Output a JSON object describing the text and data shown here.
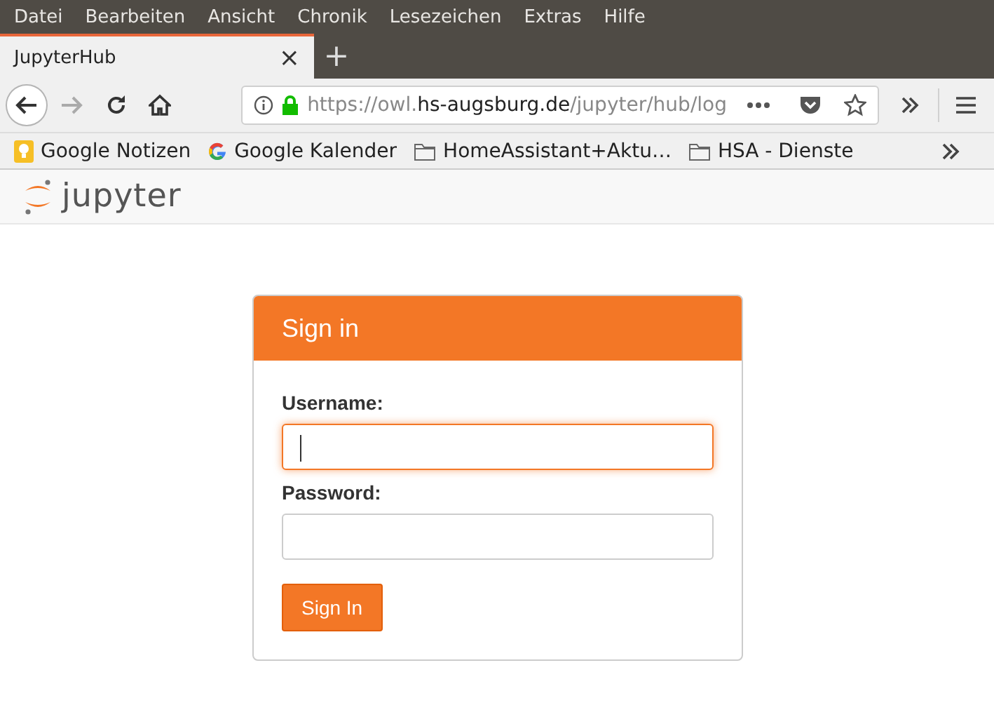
{
  "menu_bar": [
    "Datei",
    "Bearbeiten",
    "Ansicht",
    "Chronik",
    "Lesezeichen",
    "Extras",
    "Hilfe"
  ],
  "tabs": [
    {
      "title": "JupyterHub",
      "selected": true,
      "close": "×"
    }
  ],
  "new_tab": "+",
  "address_bar": {
    "prefix": "https://owl.",
    "domain": "hs-augsburg.de",
    "path": "/jupyter/hub/log",
    "secure": true
  },
  "bookmarks": [
    {
      "label": "Google Notizen",
      "kind": "notes"
    },
    {
      "label": "Google Kalender",
      "kind": "google"
    },
    {
      "label": "HomeAssistant+Aktu…",
      "kind": "folder"
    },
    {
      "label": "HSA - Dienste",
      "kind": "folder"
    }
  ],
  "site_header": {
    "logo_text": "jupyter"
  },
  "login": {
    "title": "Sign in",
    "fields": [
      {
        "label": "Username:",
        "focused": true
      },
      {
        "label": "Password:",
        "focused": false
      }
    ],
    "button": "Sign In"
  }
}
